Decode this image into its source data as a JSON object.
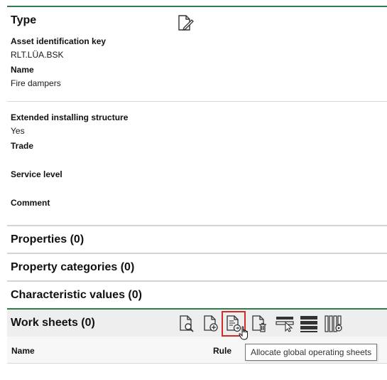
{
  "type_section": {
    "title": "Type",
    "fields": [
      {
        "label": "Asset identification key",
        "value": "RLT.LÜA.BSK"
      },
      {
        "label": "Name",
        "value": "Fire dampers"
      }
    ],
    "fields2": [
      {
        "label": "Extended installing structure",
        "value": "Yes"
      },
      {
        "label": "Trade",
        "value": ""
      },
      {
        "label": "Service level",
        "value": ""
      },
      {
        "label": "Comment",
        "value": ""
      }
    ],
    "edit_icon": "edit-document-icon"
  },
  "sections": {
    "properties": "Properties (0)",
    "property_categories": "Property categories (0)",
    "characteristic_values": "Characteristic values (0)",
    "work_sheets": "Work sheets (0)"
  },
  "work_sheets_toolbar": {
    "icons": [
      "view-document-icon",
      "add-document-icon",
      "allocate-global-sheet-icon",
      "delete-document-icon",
      "select-icon",
      "list-view-icon",
      "column-settings-icon"
    ]
  },
  "table": {
    "columns": [
      "Name",
      "Rule"
    ]
  },
  "tooltip": "Allocate global operating sheets",
  "colors": {
    "accent_green": "#2e7d4a",
    "highlight_red": "#d22b2b"
  }
}
